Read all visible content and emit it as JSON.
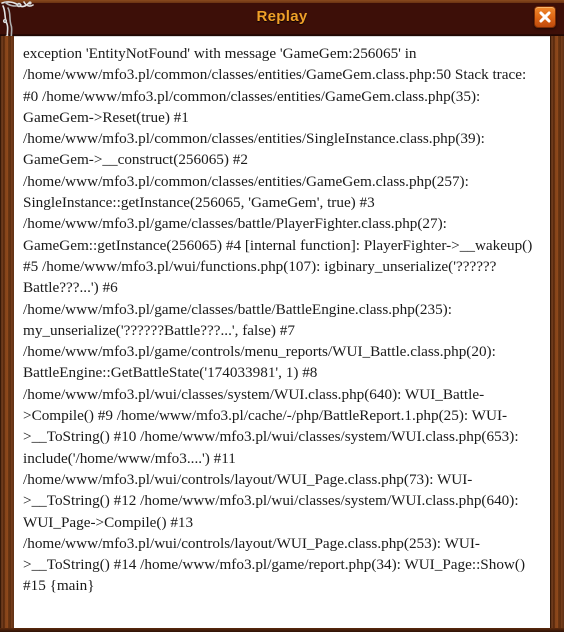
{
  "window": {
    "title": "Replay",
    "close_label": "✕",
    "title_color": "#f0a028",
    "frame_color": "#6b3312",
    "titlebar_color": "#3d0f08",
    "close_button_color": "#e06a18",
    "content_background": "#ffffff"
  },
  "icons": {
    "close": "close-icon",
    "ornament": "corner-ornament-icon"
  },
  "content": {
    "stack_trace": "exception 'EntityNotFound' with message 'GameGem:256065' in /home/www/mfo3.pl/common/classes/entities/GameGem.class.php:50 Stack trace: #0 /home/www/mfo3.pl/common/classes/entities/GameGem.class.php(35): GameGem->Reset(true) #1 /home/www/mfo3.pl/common/classes/entities/SingleInstance.class.php(39): GameGem->__construct(256065) #2 /home/www/mfo3.pl/common/classes/entities/GameGem.class.php(257): SingleInstance::getInstance(256065, 'GameGem', true) #3 /home/www/mfo3.pl/game/classes/battle/PlayerFighter.class.php(27): GameGem::getInstance(256065) #4 [internal function]: PlayerFighter->__wakeup() #5 /home/www/mfo3.pl/wui/functions.php(107): igbinary_unserialize('??????Battle???...') #6 /home/www/mfo3.pl/game/classes/battle/BattleEngine.class.php(235): my_unserialize('??????Battle???...', false) #7 /home/www/mfo3.pl/game/controls/menu_reports/WUI_Battle.class.php(20): BattleEngine::GetBattleState('174033981', 1) #8 /home/www/mfo3.pl/wui/classes/system/WUI.class.php(640): WUI_Battle->Compile() #9 /home/www/mfo3.pl/cache/-/php/BattleReport.1.php(25): WUI->__ToString() #10 /home/www/mfo3.pl/wui/classes/system/WUI.class.php(653): include('/home/www/mfo3....') #11 /home/www/mfo3.pl/wui/controls/layout/WUI_Page.class.php(73): WUI->__ToString() #12 /home/www/mfo3.pl/wui/classes/system/WUI.class.php(640): WUI_Page->Compile() #13 /home/www/mfo3.pl/wui/controls/layout/WUI_Page.class.php(253): WUI->__ToString() #14 /home/www/mfo3.pl/game/report.php(34): WUI_Page::Show() #15 {main}",
    "exception_class": "EntityNotFound",
    "exception_message": "GameGem:256065",
    "exception_file": "/home/www/mfo3.pl/common/classes/entities/GameGem.class.php",
    "exception_line": "50"
  }
}
